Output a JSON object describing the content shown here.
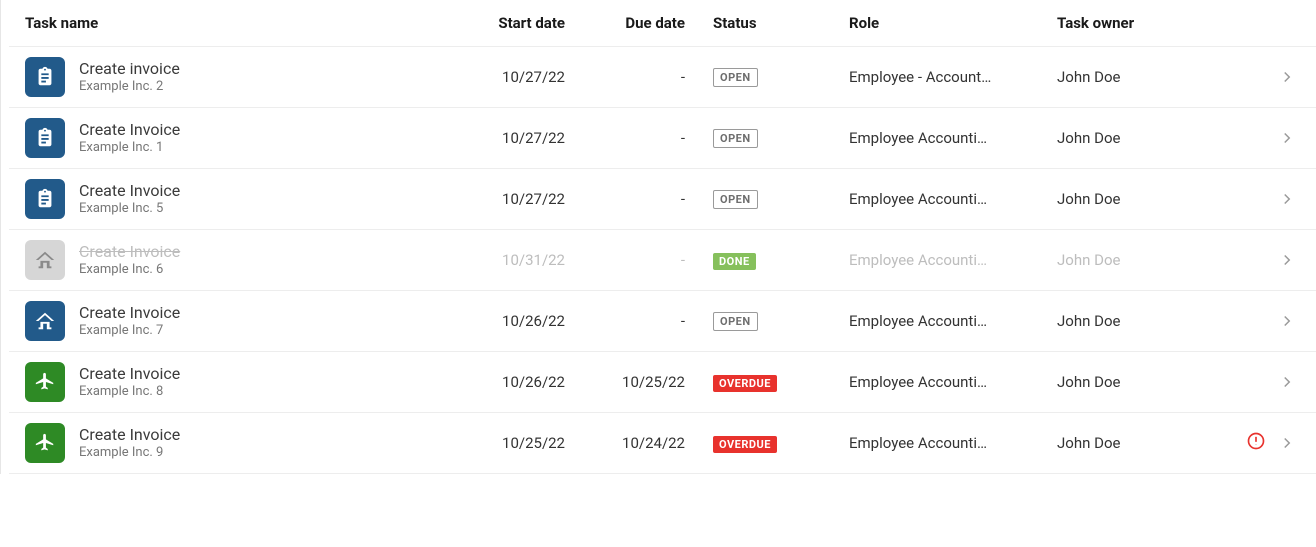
{
  "headers": {
    "task": "Task name",
    "start": "Start date",
    "due": "Due date",
    "status": "Status",
    "role": "Role",
    "owner": "Task owner"
  },
  "status_labels": {
    "open": "OPEN",
    "done": "DONE",
    "overdue": "OVERDUE"
  },
  "rows": [
    {
      "icon": "clipboard",
      "icon_color": "blue",
      "title": "Create invoice",
      "subtitle": "Example Inc. 2",
      "start": "10/27/22",
      "due": "-",
      "status": "open",
      "role": "Employee - Account…",
      "owner": "John Doe",
      "done": false,
      "alert": false
    },
    {
      "icon": "clipboard",
      "icon_color": "blue",
      "title": "Create Invoice",
      "subtitle": "Example Inc. 1",
      "start": "10/27/22",
      "due": "-",
      "status": "open",
      "role": "Employee Accounti…",
      "owner": "John Doe",
      "done": false,
      "alert": false
    },
    {
      "icon": "clipboard",
      "icon_color": "blue",
      "title": "Create Invoice",
      "subtitle": "Example Inc. 5",
      "start": "10/27/22",
      "due": "-",
      "status": "open",
      "role": "Employee Accounti…",
      "owner": "John Doe",
      "done": false,
      "alert": false
    },
    {
      "icon": "house",
      "icon_color": "grey",
      "title": "Create Invoice",
      "subtitle": "Example Inc. 6",
      "start": "10/31/22",
      "due": "-",
      "status": "done",
      "role": "Employee Accounti…",
      "owner": "John Doe",
      "done": true,
      "alert": false
    },
    {
      "icon": "house",
      "icon_color": "blue",
      "title": "Create Invoice",
      "subtitle": "Example Inc. 7",
      "start": "10/26/22",
      "due": "-",
      "status": "open",
      "role": "Employee Accounti…",
      "owner": "John Doe",
      "done": false,
      "alert": false
    },
    {
      "icon": "plane",
      "icon_color": "green",
      "title": "Create Invoice",
      "subtitle": "Example Inc. 8",
      "start": "10/26/22",
      "due": "10/25/22",
      "status": "overdue",
      "role": "Employee Accounti…",
      "owner": "John Doe",
      "done": false,
      "alert": false
    },
    {
      "icon": "plane",
      "icon_color": "green",
      "title": "Create Invoice",
      "subtitle": "Example Inc. 9",
      "start": "10/25/22",
      "due": "10/24/22",
      "status": "overdue",
      "role": "Employee Accounti…",
      "owner": "John Doe",
      "done": false,
      "alert": true
    }
  ]
}
